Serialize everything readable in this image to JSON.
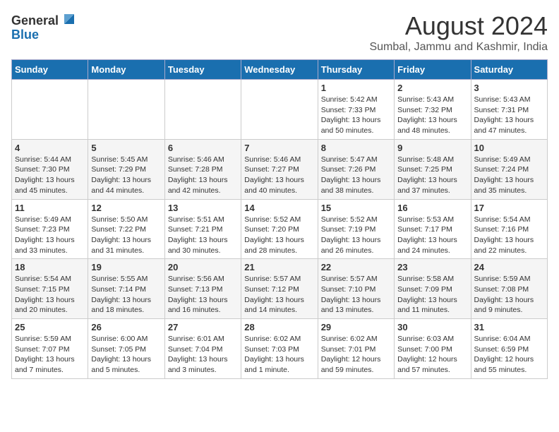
{
  "logo": {
    "general": "General",
    "blue": "Blue"
  },
  "title": "August 2024",
  "subtitle": "Sumbal, Jammu and Kashmir, India",
  "weekdays": [
    "Sunday",
    "Monday",
    "Tuesday",
    "Wednesday",
    "Thursday",
    "Friday",
    "Saturday"
  ],
  "weeks": [
    [
      {
        "day": "",
        "info": ""
      },
      {
        "day": "",
        "info": ""
      },
      {
        "day": "",
        "info": ""
      },
      {
        "day": "",
        "info": ""
      },
      {
        "day": "1",
        "info": "Sunrise: 5:42 AM\nSunset: 7:33 PM\nDaylight: 13 hours\nand 50 minutes."
      },
      {
        "day": "2",
        "info": "Sunrise: 5:43 AM\nSunset: 7:32 PM\nDaylight: 13 hours\nand 48 minutes."
      },
      {
        "day": "3",
        "info": "Sunrise: 5:43 AM\nSunset: 7:31 PM\nDaylight: 13 hours\nand 47 minutes."
      }
    ],
    [
      {
        "day": "4",
        "info": "Sunrise: 5:44 AM\nSunset: 7:30 PM\nDaylight: 13 hours\nand 45 minutes."
      },
      {
        "day": "5",
        "info": "Sunrise: 5:45 AM\nSunset: 7:29 PM\nDaylight: 13 hours\nand 44 minutes."
      },
      {
        "day": "6",
        "info": "Sunrise: 5:46 AM\nSunset: 7:28 PM\nDaylight: 13 hours\nand 42 minutes."
      },
      {
        "day": "7",
        "info": "Sunrise: 5:46 AM\nSunset: 7:27 PM\nDaylight: 13 hours\nand 40 minutes."
      },
      {
        "day": "8",
        "info": "Sunrise: 5:47 AM\nSunset: 7:26 PM\nDaylight: 13 hours\nand 38 minutes."
      },
      {
        "day": "9",
        "info": "Sunrise: 5:48 AM\nSunset: 7:25 PM\nDaylight: 13 hours\nand 37 minutes."
      },
      {
        "day": "10",
        "info": "Sunrise: 5:49 AM\nSunset: 7:24 PM\nDaylight: 13 hours\nand 35 minutes."
      }
    ],
    [
      {
        "day": "11",
        "info": "Sunrise: 5:49 AM\nSunset: 7:23 PM\nDaylight: 13 hours\nand 33 minutes."
      },
      {
        "day": "12",
        "info": "Sunrise: 5:50 AM\nSunset: 7:22 PM\nDaylight: 13 hours\nand 31 minutes."
      },
      {
        "day": "13",
        "info": "Sunrise: 5:51 AM\nSunset: 7:21 PM\nDaylight: 13 hours\nand 30 minutes."
      },
      {
        "day": "14",
        "info": "Sunrise: 5:52 AM\nSunset: 7:20 PM\nDaylight: 13 hours\nand 28 minutes."
      },
      {
        "day": "15",
        "info": "Sunrise: 5:52 AM\nSunset: 7:19 PM\nDaylight: 13 hours\nand 26 minutes."
      },
      {
        "day": "16",
        "info": "Sunrise: 5:53 AM\nSunset: 7:17 PM\nDaylight: 13 hours\nand 24 minutes."
      },
      {
        "day": "17",
        "info": "Sunrise: 5:54 AM\nSunset: 7:16 PM\nDaylight: 13 hours\nand 22 minutes."
      }
    ],
    [
      {
        "day": "18",
        "info": "Sunrise: 5:54 AM\nSunset: 7:15 PM\nDaylight: 13 hours\nand 20 minutes."
      },
      {
        "day": "19",
        "info": "Sunrise: 5:55 AM\nSunset: 7:14 PM\nDaylight: 13 hours\nand 18 minutes."
      },
      {
        "day": "20",
        "info": "Sunrise: 5:56 AM\nSunset: 7:13 PM\nDaylight: 13 hours\nand 16 minutes."
      },
      {
        "day": "21",
        "info": "Sunrise: 5:57 AM\nSunset: 7:12 PM\nDaylight: 13 hours\nand 14 minutes."
      },
      {
        "day": "22",
        "info": "Sunrise: 5:57 AM\nSunset: 7:10 PM\nDaylight: 13 hours\nand 13 minutes."
      },
      {
        "day": "23",
        "info": "Sunrise: 5:58 AM\nSunset: 7:09 PM\nDaylight: 13 hours\nand 11 minutes."
      },
      {
        "day": "24",
        "info": "Sunrise: 5:59 AM\nSunset: 7:08 PM\nDaylight: 13 hours\nand 9 minutes."
      }
    ],
    [
      {
        "day": "25",
        "info": "Sunrise: 5:59 AM\nSunset: 7:07 PM\nDaylight: 13 hours\nand 7 minutes."
      },
      {
        "day": "26",
        "info": "Sunrise: 6:00 AM\nSunset: 7:05 PM\nDaylight: 13 hours\nand 5 minutes."
      },
      {
        "day": "27",
        "info": "Sunrise: 6:01 AM\nSunset: 7:04 PM\nDaylight: 13 hours\nand 3 minutes."
      },
      {
        "day": "28",
        "info": "Sunrise: 6:02 AM\nSunset: 7:03 PM\nDaylight: 13 hours\nand 1 minute."
      },
      {
        "day": "29",
        "info": "Sunrise: 6:02 AM\nSunset: 7:01 PM\nDaylight: 12 hours\nand 59 minutes."
      },
      {
        "day": "30",
        "info": "Sunrise: 6:03 AM\nSunset: 7:00 PM\nDaylight: 12 hours\nand 57 minutes."
      },
      {
        "day": "31",
        "info": "Sunrise: 6:04 AM\nSunset: 6:59 PM\nDaylight: 12 hours\nand 55 minutes."
      }
    ]
  ]
}
